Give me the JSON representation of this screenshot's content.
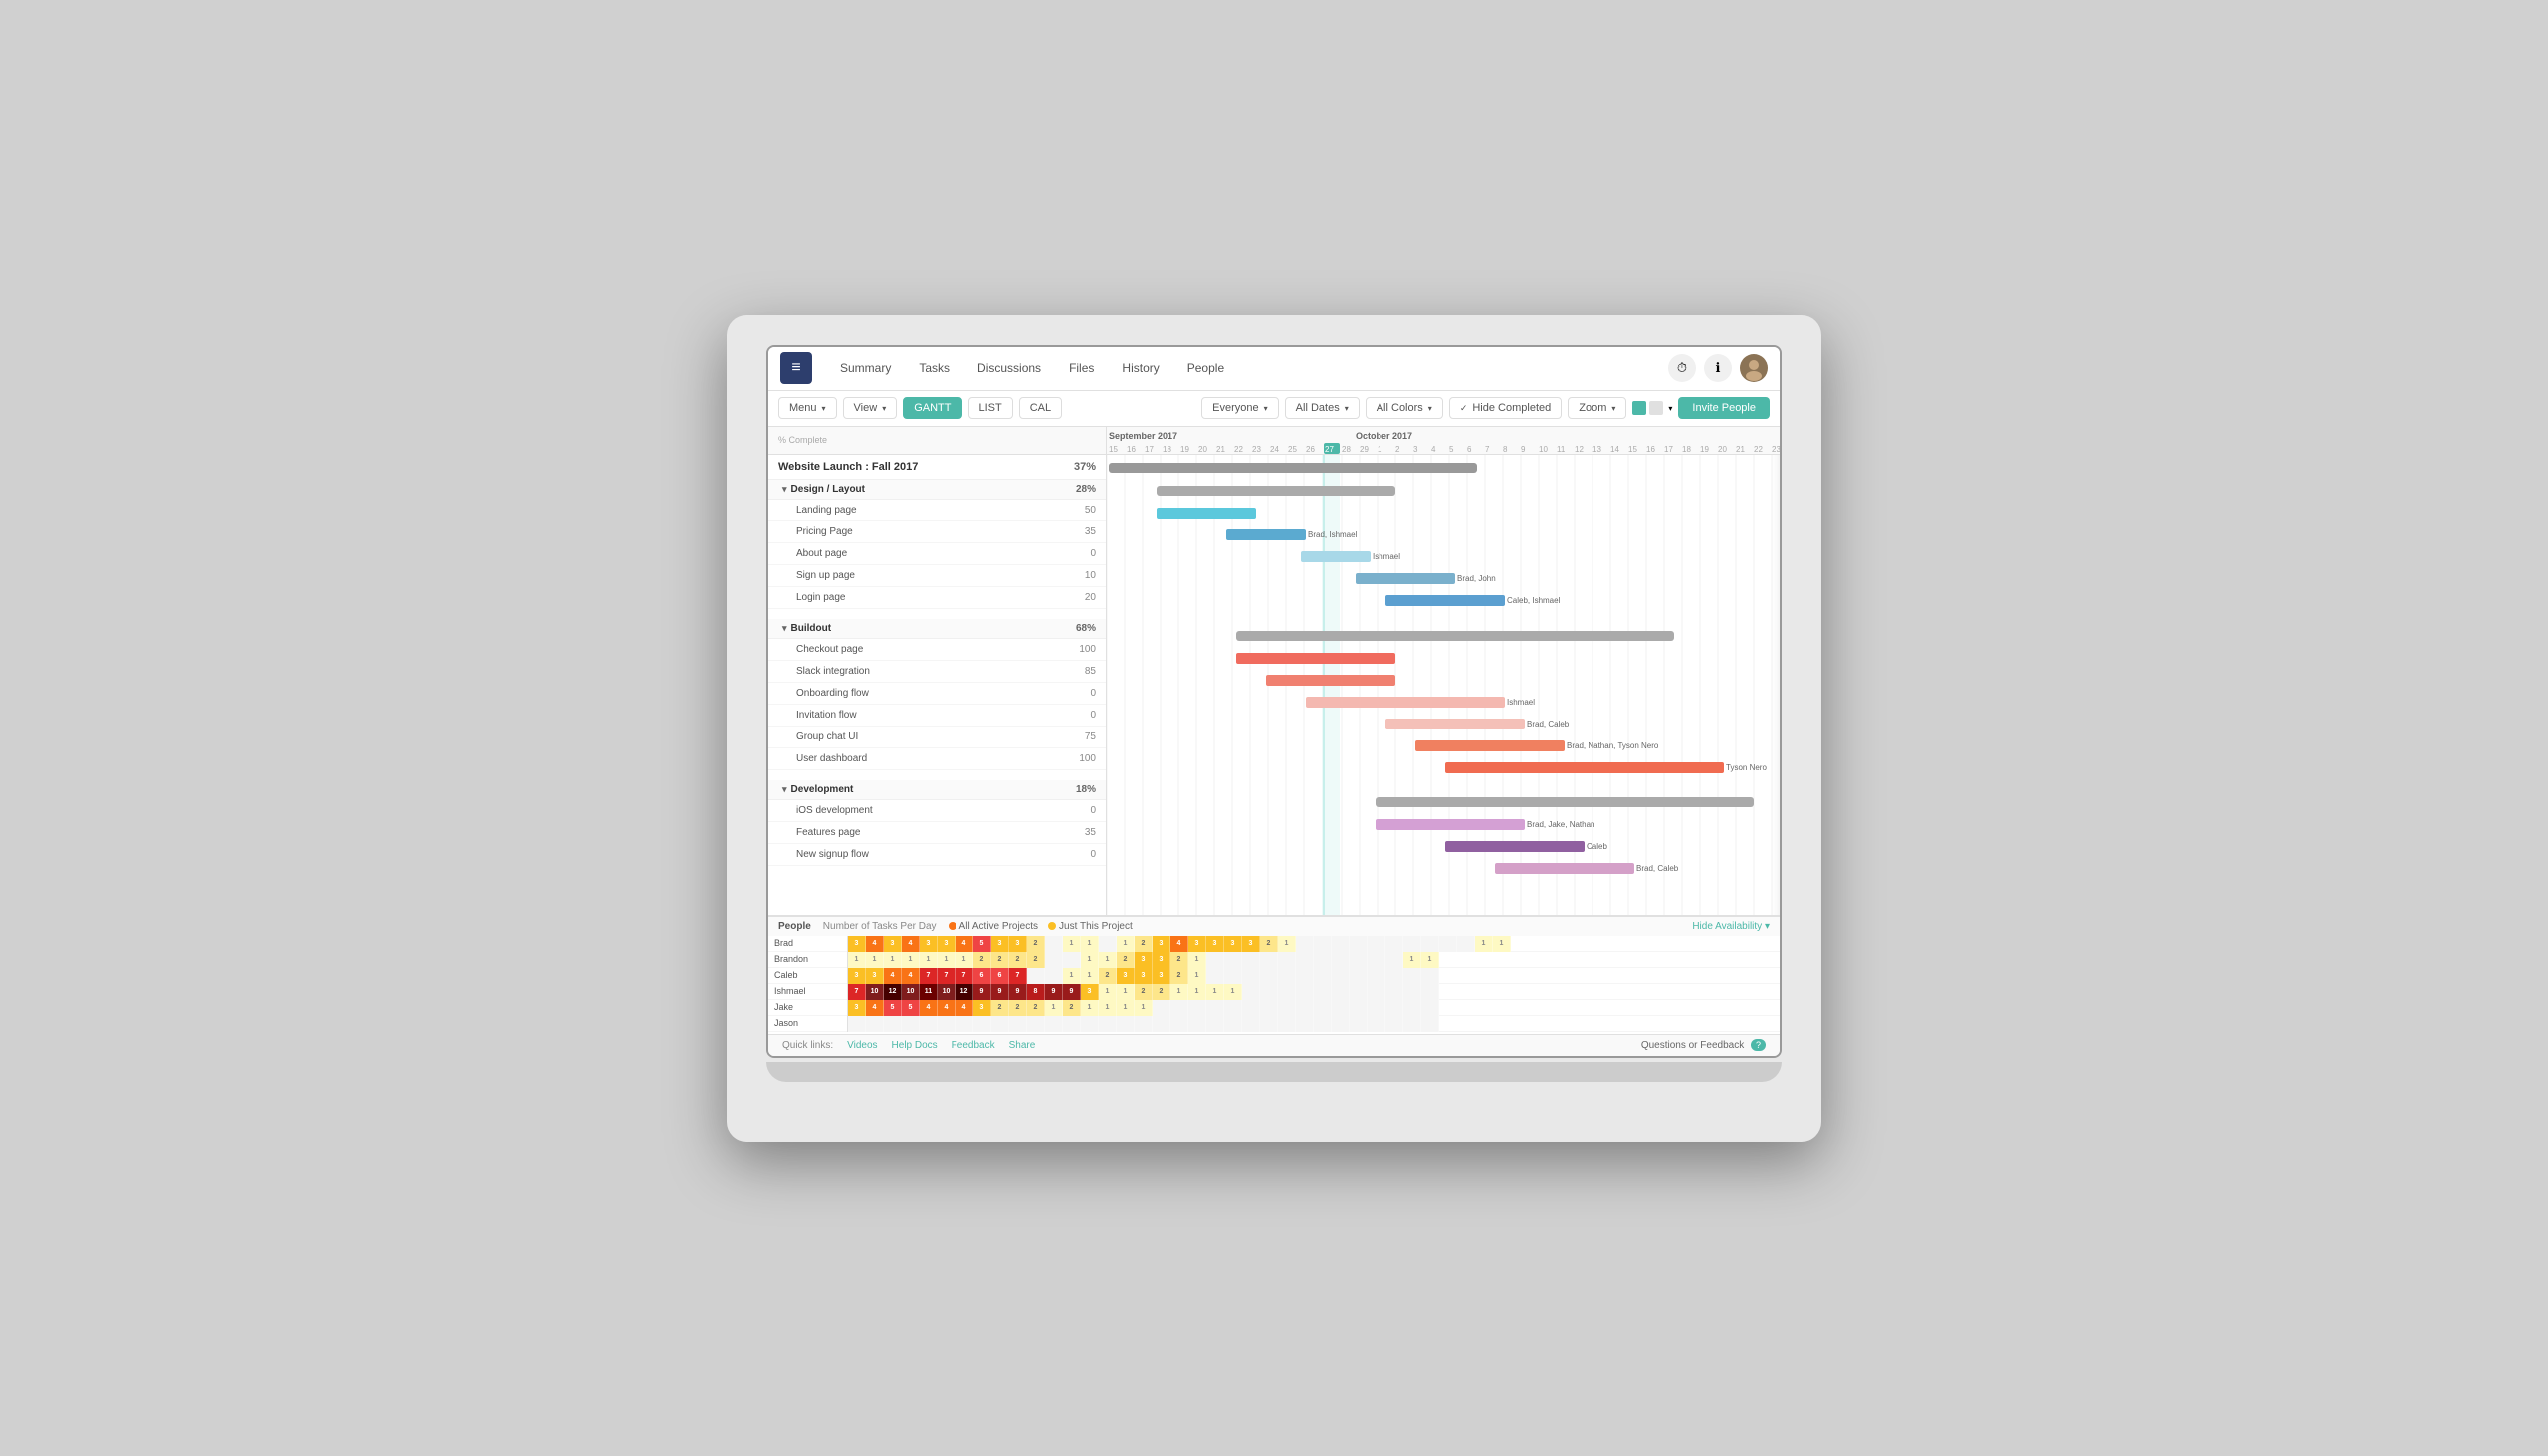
{
  "nav": {
    "logo": "≡",
    "tabs": [
      "Summary",
      "Tasks",
      "Discussions",
      "Files",
      "History",
      "People"
    ]
  },
  "toolbar": {
    "menu": "Menu",
    "view": "View",
    "gantt": "GANTT",
    "list": "LIST",
    "cal": "CAL",
    "everyone": "Everyone",
    "allDates": "All Dates",
    "allColors": "All Colors",
    "hideCompleted": "Hide Completed",
    "zoom": "Zoom",
    "invitePeople": "Invite People"
  },
  "project": {
    "title": "Website Launch : Fall 2017",
    "pct": "37%",
    "sections": [
      {
        "name": "Design / Layout",
        "pct": "28%",
        "tasks": [
          {
            "name": "Landing page",
            "pct": "50"
          },
          {
            "name": "Pricing Page",
            "pct": "35"
          },
          {
            "name": "About page",
            "pct": "0"
          },
          {
            "name": "Sign up page",
            "pct": "10"
          },
          {
            "name": "Login page",
            "pct": "20"
          }
        ]
      },
      {
        "name": "Buildout",
        "pct": "68%",
        "tasks": [
          {
            "name": "Checkout page",
            "pct": "100"
          },
          {
            "name": "Slack integration",
            "pct": "85"
          },
          {
            "name": "Onboarding flow",
            "pct": "0"
          },
          {
            "name": "Invitation flow",
            "pct": "0"
          },
          {
            "name": "Group chat UI",
            "pct": "75"
          },
          {
            "name": "User dashboard",
            "pct": "100"
          }
        ]
      },
      {
        "name": "Development",
        "pct": "18%",
        "tasks": [
          {
            "name": "iOS development",
            "pct": "0"
          },
          {
            "name": "Features page",
            "pct": "35"
          },
          {
            "name": "New signup flow",
            "pct": "0"
          }
        ]
      }
    ]
  },
  "availability": {
    "title": "People",
    "tasksLabel": "Number of Tasks Per Day",
    "legend": [
      {
        "label": "All Active Projects",
        "color": "#f97316"
      },
      {
        "label": "Just This Project",
        "color": "#fbbf24"
      }
    ],
    "hideBtn": "Hide Availability",
    "people": [
      {
        "name": "Brad",
        "values": [
          3,
          4,
          3,
          4,
          3,
          3,
          4,
          5,
          3,
          3,
          2,
          0,
          1,
          1,
          0,
          1,
          2,
          3,
          4,
          3,
          3,
          3,
          3,
          2,
          1,
          0,
          0,
          0,
          0,
          0,
          0,
          0,
          0,
          0,
          0,
          1,
          1
        ]
      },
      {
        "name": "Brandon",
        "values": [
          1,
          1,
          1,
          1,
          1,
          1,
          1,
          2,
          2,
          2,
          2,
          0,
          0,
          1,
          1,
          2,
          3,
          3,
          2,
          1,
          0,
          0,
          0,
          0,
          0,
          0,
          0,
          0,
          0,
          0,
          0,
          1,
          1
        ]
      },
      {
        "name": "Caleb",
        "values": [
          3,
          3,
          4,
          4,
          7,
          7,
          7,
          6,
          6,
          7,
          0,
          0,
          1,
          1,
          2,
          3,
          3,
          3,
          2,
          1,
          0,
          0,
          0,
          0,
          0,
          0,
          0,
          0,
          0,
          0,
          0,
          0,
          0
        ]
      },
      {
        "name": "Ishmael",
        "values": [
          7,
          10,
          12,
          10,
          11,
          10,
          12,
          9,
          9,
          9,
          8,
          9,
          9,
          3,
          1,
          1,
          2,
          2,
          1,
          1,
          1,
          1,
          0,
          0,
          0,
          0,
          0,
          0,
          0,
          0,
          0,
          0,
          0
        ]
      },
      {
        "name": "Jake",
        "values": [
          3,
          4,
          5,
          5,
          4,
          4,
          4,
          3,
          2,
          2,
          2,
          1,
          2,
          1,
          1,
          1,
          1,
          0,
          0,
          0,
          0,
          0,
          0,
          0,
          0,
          0,
          0,
          0,
          0,
          0,
          0,
          0,
          0
        ]
      },
      {
        "name": "Jason",
        "values": [
          0,
          0,
          0,
          0,
          0,
          0,
          0,
          0,
          0,
          0,
          0,
          0,
          0,
          0,
          0,
          0,
          0,
          0,
          0,
          0,
          0,
          0,
          0,
          0,
          0,
          0,
          0,
          0,
          0,
          0,
          0,
          0,
          0
        ]
      }
    ]
  },
  "footer": {
    "quickLinks": "Quick links:",
    "links": [
      "Videos",
      "Help Docs",
      "Feedback",
      "Share"
    ],
    "feedback": "Questions or Feedback",
    "badge": "?"
  },
  "colors": {
    "teal": "#4cb8a8",
    "navBg": "#2d3e6d"
  }
}
